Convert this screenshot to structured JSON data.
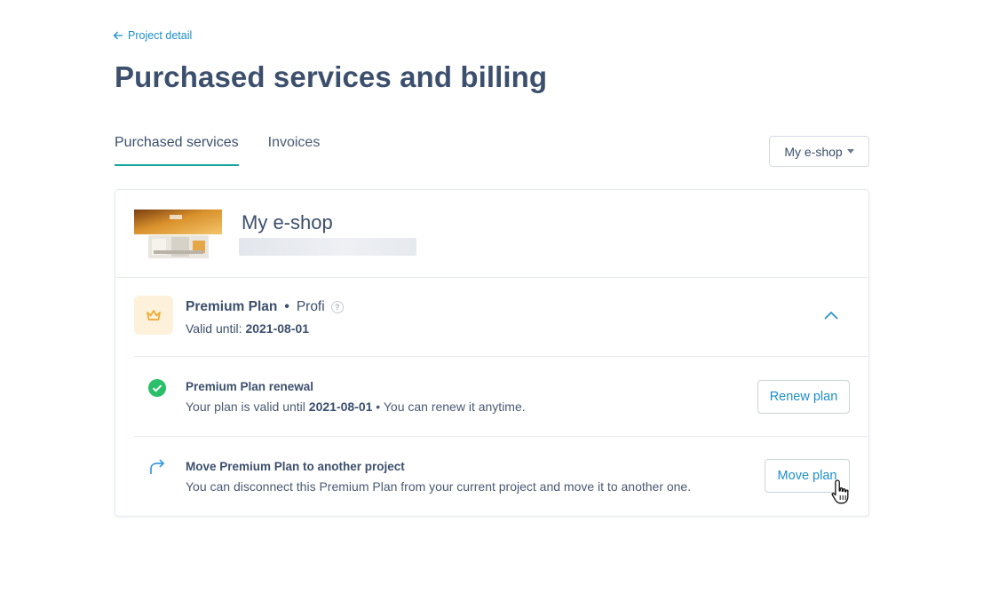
{
  "back_link": {
    "label": "Project detail"
  },
  "page": {
    "title": "Purchased services and billing"
  },
  "tabs": [
    {
      "label": "Purchased services",
      "active": true
    },
    {
      "label": "Invoices",
      "active": false
    }
  ],
  "project_select": {
    "selected": "My e-shop"
  },
  "project": {
    "name": "My e-shop"
  },
  "plan": {
    "name": "Premium Plan",
    "separator": "•",
    "tier": "Profi",
    "valid_label": "Valid until: ",
    "valid_date": "2021-08-01"
  },
  "services": {
    "renewal": {
      "title": "Premium Plan renewal",
      "desc_prefix": "Your plan is valid until ",
      "desc_date": "2021-08-01",
      "desc_suffix": " • You can renew it anytime.",
      "button": "Renew plan"
    },
    "move": {
      "title": "Move Premium Plan to another project",
      "desc": "You can disconnect this Premium Plan from your current project and move it to another one.",
      "button": "Move plan"
    }
  },
  "colors": {
    "accent": "#1b8fc9",
    "tab_underline": "#1aa39e",
    "success": "#2bbf6a",
    "crown": "#f0a92a"
  }
}
